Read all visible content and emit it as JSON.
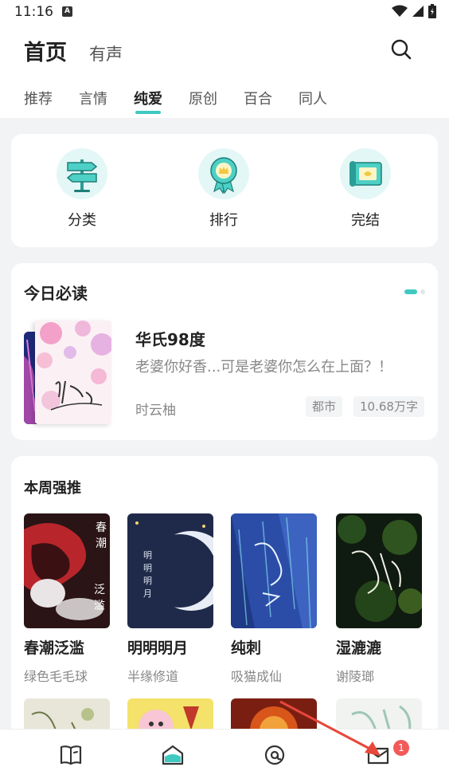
{
  "status_bar": {
    "time": "11:16",
    "notification_icon": "a-icon",
    "icons": [
      "wifi-icon",
      "signal-icon",
      "battery-icon"
    ]
  },
  "header": {
    "tabs": [
      "首页",
      "有声"
    ],
    "active_tab": "首页",
    "search_icon": "search-icon"
  },
  "sub_tabs": {
    "items": [
      "推荐",
      "言情",
      "纯爱",
      "原创",
      "百合",
      "同人"
    ],
    "active": "纯爱"
  },
  "categories": [
    {
      "label": "分类",
      "icon": "signpost-icon"
    },
    {
      "label": "排行",
      "icon": "award-icon"
    },
    {
      "label": "完结",
      "icon": "scroll-icon"
    }
  ],
  "daily": {
    "title": "今日必读",
    "book": {
      "title": "华氏98度",
      "description": "老婆你好香...可是老婆你怎么在上面？！",
      "author": "时云柚",
      "tags": [
        "都市",
        "10.68万字"
      ]
    }
  },
  "weekly": {
    "title": "本周强推",
    "books": [
      {
        "title": "春潮泛滥",
        "author": "绿色毛毛球"
      },
      {
        "title": "明明明月",
        "author": "半缘修道"
      },
      {
        "title": "纯刺",
        "author": "吸猫成仙"
      },
      {
        "title": "湿漉漉",
        "author": "谢陵瑯"
      }
    ]
  },
  "bottom_nav": {
    "items": [
      "book-icon",
      "home-icon",
      "at-icon",
      "message-icon"
    ],
    "badge": "1"
  },
  "colors": {
    "accent": "#3fc9c1",
    "badge": "#f25a5a",
    "annotation_arrow": "#e8473b"
  }
}
